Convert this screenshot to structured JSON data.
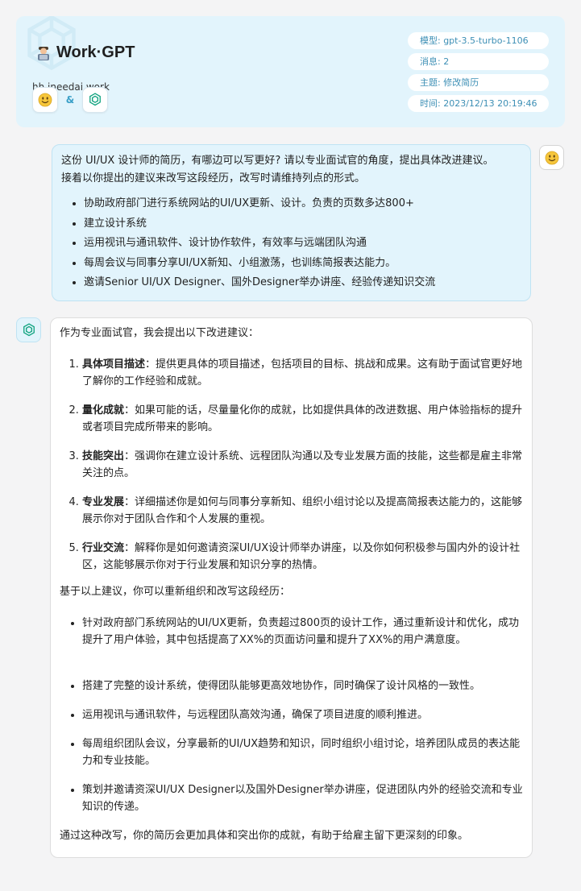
{
  "header": {
    "brand": "Work·GPT",
    "domain": "hh.ineedai.work",
    "amp": "&",
    "meta": [
      "模型: gpt-3.5-turbo-1106",
      "消息: 2",
      "主题: 修改简历",
      "时间: 2023/12/13 20:19:46"
    ],
    "icons": {
      "brand": "office-worker-emoji-icon",
      "user": "smiley-icon",
      "assistant": "openai-logo-icon"
    }
  },
  "user_message": {
    "intro_1": "这份 UI/UX 设计师的简历，有哪边可以写更好? 请以专业面试官的角度，提出具体改进建议。",
    "intro_2": "接着以你提出的建议来改写这段经历，改写时请维持列点的形式。",
    "items": [
      "协助政府部门进行系统网站的UI/UX更新、设计。负责的页数多达800+",
      "建立设计系统",
      "运用视讯与通讯软件、设计协作软件，有效率与远端团队沟通",
      "每周会议与同事分享UI/UX新知、小组激荡，也训练简报表达能力。",
      "邀请Senior UI/UX Designer、国外Designer举办讲座、经验传递知识交流"
    ]
  },
  "assistant_message": {
    "intro": "作为专业面试官，我会提出以下改进建议：",
    "suggestions": [
      {
        "title": "具体项目描述",
        "text": "：提供更具体的项目描述，包括项目的目标、挑战和成果。这有助于面试官更好地了解你的工作经验和成就。"
      },
      {
        "title": "量化成就",
        "text": "：如果可能的话，尽量量化你的成就，比如提供具体的改进数据、用户体验指标的提升或者项目完成所带来的影响。"
      },
      {
        "title": "技能突出",
        "text": "：强调你在建立设计系统、远程团队沟通以及专业发展方面的技能，这些都是雇主非常关注的点。"
      },
      {
        "title": "专业发展",
        "text": "：详细描述你是如何与同事分享新知、组织小组讨论以及提高简报表达能力的，这能够展示你对于团队合作和个人发展的重视。"
      },
      {
        "title": "行业交流",
        "text": "：解释你是如何邀请资深UI/UX设计师举办讲座，以及你如何积极参与国内外的设计社区，这能够展示你对于行业发展和知识分享的热情。"
      }
    ],
    "transition": "基于以上建议，你可以重新组织和改写这段经历：",
    "rewrites": [
      "针对政府部门系统网站的UI/UX更新，负责超过800页的设计工作，通过重新设计和优化，成功提升了用户体验，其中包括提高了XX%的页面访问量和提升了XX%的用户满意度。",
      "搭建了完整的设计系统，使得团队能够更高效地协作，同时确保了设计风格的一致性。",
      "运用视讯与通讯软件，与远程团队高效沟通，确保了项目进度的顺利推进。",
      "每周组织团队会议，分享最新的UI/UX趋势和知识，同时组织小组讨论，培养团队成员的表达能力和专业技能。",
      "策划并邀请资深UI/UX Designer以及国外Designer举办讲座，促进团队内外的经验交流和专业知识的传递。"
    ],
    "closing": "通过这种改写，你的简历会更加具体和突出你的成就，有助于给雇主留下更深刻的印象。"
  }
}
